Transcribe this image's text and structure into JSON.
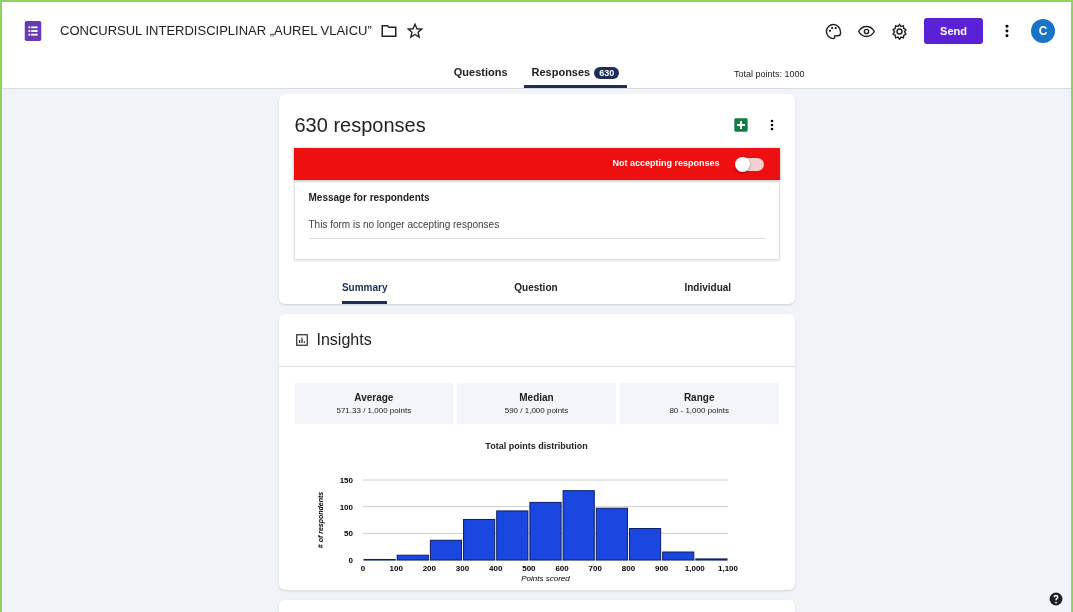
{
  "header": {
    "title": "CONCURSUL INTERDISCIPLINAR „AUREL VLAICU”",
    "send_label": "Send",
    "avatar": "C"
  },
  "tabs": [
    {
      "label": "Questions",
      "selected": false
    },
    {
      "label": "Responses",
      "selected": true,
      "badge": "630"
    }
  ],
  "total_points": "Total points: 1000",
  "responses_card": {
    "title": "630 responses",
    "accepting": false,
    "status_label": "Not accepting responses",
    "message_heading": "Message for respondents",
    "message": "This form is no longer accepting responses",
    "views": [
      {
        "label": "Summary",
        "selected": true
      },
      {
        "label": "Question",
        "selected": false
      },
      {
        "label": "Individual",
        "selected": false
      }
    ]
  },
  "insights": {
    "title": "Insights",
    "stats": [
      {
        "label": "Average",
        "value": "571.33 / 1,000 points"
      },
      {
        "label": "Median",
        "value": "590 / 1,000 points"
      },
      {
        "label": "Range",
        "value": "80 - 1,000 points"
      }
    ],
    "chart_data": {
      "type": "bar",
      "title": "Total points distribution",
      "xlabel": "Points scored",
      "ylabel": "# of respondents",
      "x": [
        50,
        150,
        250,
        350,
        450,
        550,
        650,
        750,
        850,
        950,
        1050
      ],
      "series": [
        {
          "color": "#1a47e0",
          "values": [
            1,
            9,
            37,
            76,
            92,
            108,
            130,
            97,
            59,
            15,
            2
          ]
        }
      ],
      "xlim": [
        0,
        1100
      ],
      "ylim": [
        0,
        150
      ],
      "xticks": [
        0,
        100,
        200,
        300,
        400,
        500,
        600,
        700,
        800,
        900,
        {
          "value": 1000,
          "label": "1,000"
        },
        {
          "value": 1100,
          "label": "1,100"
        }
      ],
      "yticks": [
        0,
        50,
        100,
        150
      ]
    }
  }
}
